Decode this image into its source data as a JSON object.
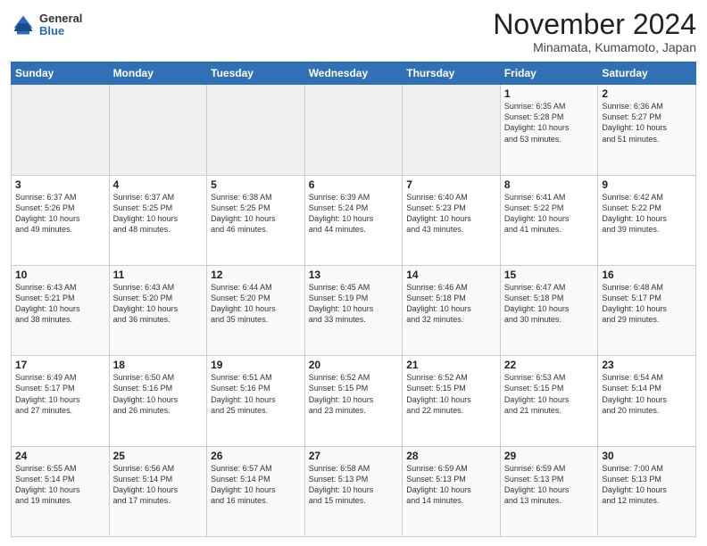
{
  "header": {
    "logo_general": "General",
    "logo_blue": "Blue",
    "month": "November 2024",
    "location": "Minamata, Kumamoto, Japan"
  },
  "days_of_week": [
    "Sunday",
    "Monday",
    "Tuesday",
    "Wednesday",
    "Thursday",
    "Friday",
    "Saturday"
  ],
  "weeks": [
    [
      {
        "day": "",
        "info": ""
      },
      {
        "day": "",
        "info": ""
      },
      {
        "day": "",
        "info": ""
      },
      {
        "day": "",
        "info": ""
      },
      {
        "day": "",
        "info": ""
      },
      {
        "day": "1",
        "info": "Sunrise: 6:35 AM\nSunset: 5:28 PM\nDaylight: 10 hours\nand 53 minutes."
      },
      {
        "day": "2",
        "info": "Sunrise: 6:36 AM\nSunset: 5:27 PM\nDaylight: 10 hours\nand 51 minutes."
      }
    ],
    [
      {
        "day": "3",
        "info": "Sunrise: 6:37 AM\nSunset: 5:26 PM\nDaylight: 10 hours\nand 49 minutes."
      },
      {
        "day": "4",
        "info": "Sunrise: 6:37 AM\nSunset: 5:25 PM\nDaylight: 10 hours\nand 48 minutes."
      },
      {
        "day": "5",
        "info": "Sunrise: 6:38 AM\nSunset: 5:25 PM\nDaylight: 10 hours\nand 46 minutes."
      },
      {
        "day": "6",
        "info": "Sunrise: 6:39 AM\nSunset: 5:24 PM\nDaylight: 10 hours\nand 44 minutes."
      },
      {
        "day": "7",
        "info": "Sunrise: 6:40 AM\nSunset: 5:23 PM\nDaylight: 10 hours\nand 43 minutes."
      },
      {
        "day": "8",
        "info": "Sunrise: 6:41 AM\nSunset: 5:22 PM\nDaylight: 10 hours\nand 41 minutes."
      },
      {
        "day": "9",
        "info": "Sunrise: 6:42 AM\nSunset: 5:22 PM\nDaylight: 10 hours\nand 39 minutes."
      }
    ],
    [
      {
        "day": "10",
        "info": "Sunrise: 6:43 AM\nSunset: 5:21 PM\nDaylight: 10 hours\nand 38 minutes."
      },
      {
        "day": "11",
        "info": "Sunrise: 6:43 AM\nSunset: 5:20 PM\nDaylight: 10 hours\nand 36 minutes."
      },
      {
        "day": "12",
        "info": "Sunrise: 6:44 AM\nSunset: 5:20 PM\nDaylight: 10 hours\nand 35 minutes."
      },
      {
        "day": "13",
        "info": "Sunrise: 6:45 AM\nSunset: 5:19 PM\nDaylight: 10 hours\nand 33 minutes."
      },
      {
        "day": "14",
        "info": "Sunrise: 6:46 AM\nSunset: 5:18 PM\nDaylight: 10 hours\nand 32 minutes."
      },
      {
        "day": "15",
        "info": "Sunrise: 6:47 AM\nSunset: 5:18 PM\nDaylight: 10 hours\nand 30 minutes."
      },
      {
        "day": "16",
        "info": "Sunrise: 6:48 AM\nSunset: 5:17 PM\nDaylight: 10 hours\nand 29 minutes."
      }
    ],
    [
      {
        "day": "17",
        "info": "Sunrise: 6:49 AM\nSunset: 5:17 PM\nDaylight: 10 hours\nand 27 minutes."
      },
      {
        "day": "18",
        "info": "Sunrise: 6:50 AM\nSunset: 5:16 PM\nDaylight: 10 hours\nand 26 minutes."
      },
      {
        "day": "19",
        "info": "Sunrise: 6:51 AM\nSunset: 5:16 PM\nDaylight: 10 hours\nand 25 minutes."
      },
      {
        "day": "20",
        "info": "Sunrise: 6:52 AM\nSunset: 5:15 PM\nDaylight: 10 hours\nand 23 minutes."
      },
      {
        "day": "21",
        "info": "Sunrise: 6:52 AM\nSunset: 5:15 PM\nDaylight: 10 hours\nand 22 minutes."
      },
      {
        "day": "22",
        "info": "Sunrise: 6:53 AM\nSunset: 5:15 PM\nDaylight: 10 hours\nand 21 minutes."
      },
      {
        "day": "23",
        "info": "Sunrise: 6:54 AM\nSunset: 5:14 PM\nDaylight: 10 hours\nand 20 minutes."
      }
    ],
    [
      {
        "day": "24",
        "info": "Sunrise: 6:55 AM\nSunset: 5:14 PM\nDaylight: 10 hours\nand 19 minutes."
      },
      {
        "day": "25",
        "info": "Sunrise: 6:56 AM\nSunset: 5:14 PM\nDaylight: 10 hours\nand 17 minutes."
      },
      {
        "day": "26",
        "info": "Sunrise: 6:57 AM\nSunset: 5:14 PM\nDaylight: 10 hours\nand 16 minutes."
      },
      {
        "day": "27",
        "info": "Sunrise: 6:58 AM\nSunset: 5:13 PM\nDaylight: 10 hours\nand 15 minutes."
      },
      {
        "day": "28",
        "info": "Sunrise: 6:59 AM\nSunset: 5:13 PM\nDaylight: 10 hours\nand 14 minutes."
      },
      {
        "day": "29",
        "info": "Sunrise: 6:59 AM\nSunset: 5:13 PM\nDaylight: 10 hours\nand 13 minutes."
      },
      {
        "day": "30",
        "info": "Sunrise: 7:00 AM\nSunset: 5:13 PM\nDaylight: 10 hours\nand 12 minutes."
      }
    ]
  ]
}
